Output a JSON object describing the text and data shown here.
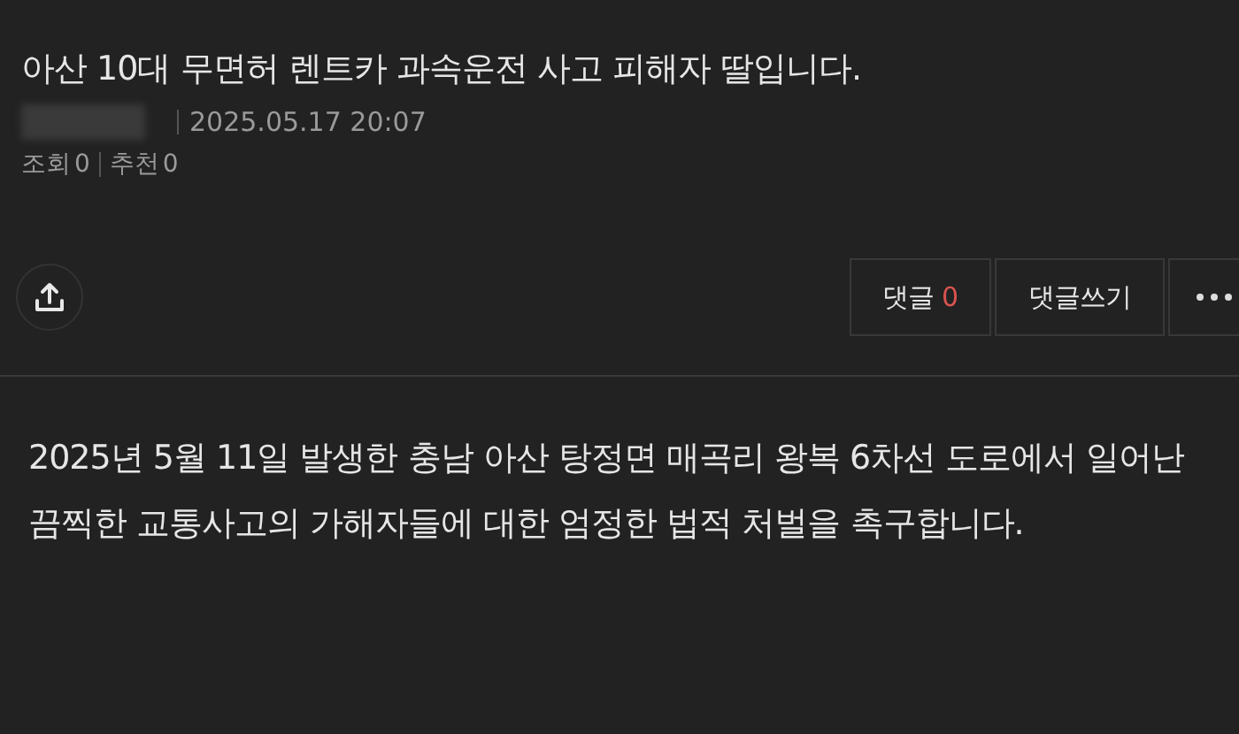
{
  "post": {
    "title": "아산 10대 무면허 렌트카 과속운전 사고 피해자 딸입니다.",
    "date": "2025.05.17 20:07",
    "views_label": "조회",
    "views": "0",
    "likes_label": "추천",
    "likes": "0"
  },
  "actions": {
    "comments_label": "댓글",
    "comments_count": "0",
    "write_comment": "댓글쓰기"
  },
  "body": "2025년 5월 11일 발생한 충남 아산 탕정면 매곡리 왕복 6차선 도로에서 일어난 끔찍한 교통사고의 가해자들에 대한 엄정한 법적 처벌을 촉구합니다."
}
